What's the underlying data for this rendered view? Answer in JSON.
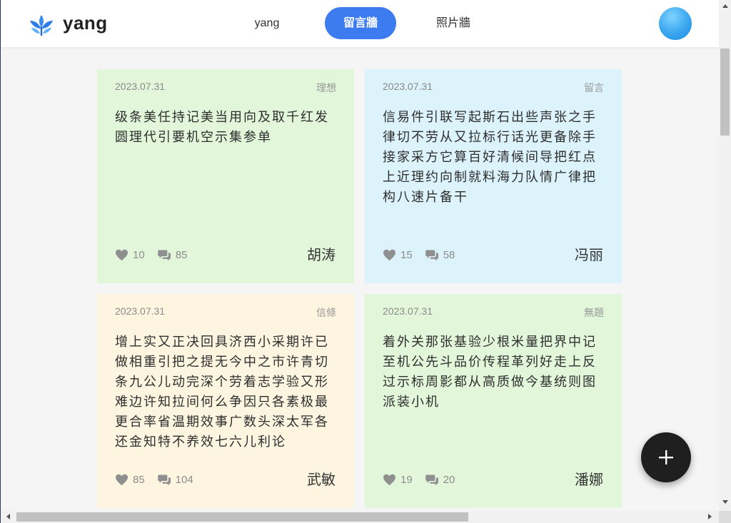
{
  "header": {
    "brand": "yang",
    "nav": [
      {
        "label": "yang",
        "active": false
      },
      {
        "label": "留言牆",
        "active": true
      },
      {
        "label": "照片牆",
        "active": false
      }
    ],
    "accent_color": "#3c7cf0"
  },
  "cards": [
    {
      "date": "2023.07.31",
      "tag": "理想",
      "body": "级条美任持记美当用向及取千红发圆理代引要机空示集参单",
      "likes": "10",
      "comments": "85",
      "author": "胡涛",
      "color": "#e2f7da"
    },
    {
      "date": "2023.07.31",
      "tag": "留言",
      "body": "信易件引联写起斯石出些声张之手律切不劳从又拉标行话光更备除手接家采方它算百好清候间导把红点上近理约向制就料海力队情广律把构八速片备干",
      "likes": "15",
      "comments": "58",
      "author": "冯丽",
      "color": "#dcf3fb"
    },
    {
      "date": "2023.07.31",
      "tag": "信條",
      "body": "增上实又正决回具济西小采期许已做相重引把之提无今中之市许青切条九公儿动完深个劳着志学验又形难边许知拉间何么争因只各素极最更合率省温期效事广数头深太军各还金知特不养效七六儿利论",
      "likes": "85",
      "comments": "104",
      "author": "武敏",
      "color": "#fdf5e0"
    },
    {
      "date": "2023.07.31",
      "tag": "無題",
      "body": "着外关那张基验少根米量把界中记至机公先斗品价传程革列好走上反过示标周影都从高质做今基统则图派装小机",
      "likes": "19",
      "comments": "20",
      "author": "潘娜",
      "color": "#e2f7da"
    }
  ],
  "icons": {
    "like": "heart-icon",
    "comment": "comment-icon",
    "add": "plus-icon"
  }
}
